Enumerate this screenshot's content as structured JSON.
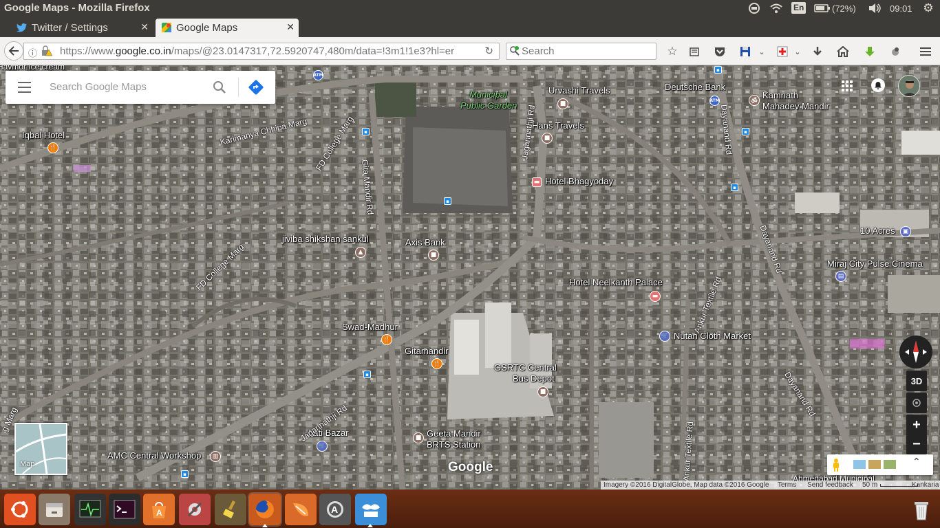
{
  "topbar": {
    "window_title": "Google Maps - Mozilla Firefox",
    "keyboard_layout": "En",
    "battery": "(72%)",
    "clock": "09:01",
    "icons": [
      "network-icon",
      "wifi-icon",
      "keyboard-icon",
      "battery-icon",
      "volume-icon",
      "settings-icon"
    ]
  },
  "tabs": [
    {
      "label": "Twitter / Settings",
      "icon": "twitter-icon",
      "active": false
    },
    {
      "label": "Google Maps",
      "icon": "google-maps-icon",
      "active": true
    }
  ],
  "navbar": {
    "url_prefix": "https://www.",
    "url_domain": "google.co.in",
    "url_rest": "/maps/@23.0147317,72.5920747,480m/data=!3m1!1e3?hl=er",
    "search_placeholder": "Search"
  },
  "map": {
    "search_placeholder": "Search Google Maps",
    "minimap_label": "Map",
    "ctrl_3d": "3D",
    "zoom_in": "+",
    "zoom_out": "−",
    "google_brand": "Google",
    "attribution": "Imagery ©2016 DigitalGlobe, Map data ©2016 Google",
    "terms": "Terms",
    "feedback": "Send feedback",
    "scale": "50 m",
    "places": {
      "havmor": "Havmor Ice cream",
      "iqbal": "Iqbal Hotel",
      "municipal1": "Municipal",
      "municipal2": "Public Garden",
      "urvashi": "Urvashi Travels",
      "hans": "Hans Travels",
      "deutsche": "Deutsche Bank",
      "kamnath1": "Kamnath",
      "kamnath2": "Mahadev Mandir",
      "bhagyoday": "Hotel Bhagyoday",
      "jiviba": "jiviba shikshan sankul",
      "axis": "Axis Bank",
      "tenacres": "10 Acres",
      "miraj": "Miraj City Pulse Cinema",
      "neelkanth": "Hotel Neelkanth Palace",
      "nutan": "Nutan Cloth Market",
      "swad": "Swad-Madhur",
      "gitamandir": "Gitamandir",
      "gsrtc1": "GSRTC Central",
      "gsrtc2": "Bus Depot",
      "latibazar": "Lati Bazar",
      "geeta1": "Geeta Mandir",
      "geeta2": "BRTS Station",
      "amc": "AMC Central Workshop",
      "ahmedabad": "Ahmedabad Municipal",
      "kankaria": "Kankaria"
    },
    "roads": {
      "karimanya": "Karimanya Chhipa Marg",
      "fdcollege1": "FD College Marg",
      "fdcollege2": "FD College Marg",
      "gitamandir": "Gita Mandir Rd",
      "jagannathji1": "Jagannathji Rd",
      "jagannathji2": "Jagannathji Rd",
      "dayanand1": "Dayanand Rd",
      "dayanand2": "Dayanand Rd",
      "dayanand3": "Dayanand Rd",
      "ankur1": "Ankur Textile Rd",
      "ankur2": "Ankur Textile Rd",
      "marg": "g Marg"
    }
  },
  "dock": {
    "apps": [
      "ubuntu-icon",
      "files-icon",
      "system-monitor-icon",
      "terminal-icon",
      "software-center-icon",
      "settings-tools-icon",
      "cleaner-icon",
      "firefox-icon",
      "orange-app-icon",
      "updater-icon",
      "remmina-icon",
      "trash-icon"
    ]
  },
  "colors": {
    "panel": "#3c3b37",
    "toolbar": "#f2f1f0",
    "dock": "#5a2610",
    "accent_blue": "#1a73e8"
  }
}
